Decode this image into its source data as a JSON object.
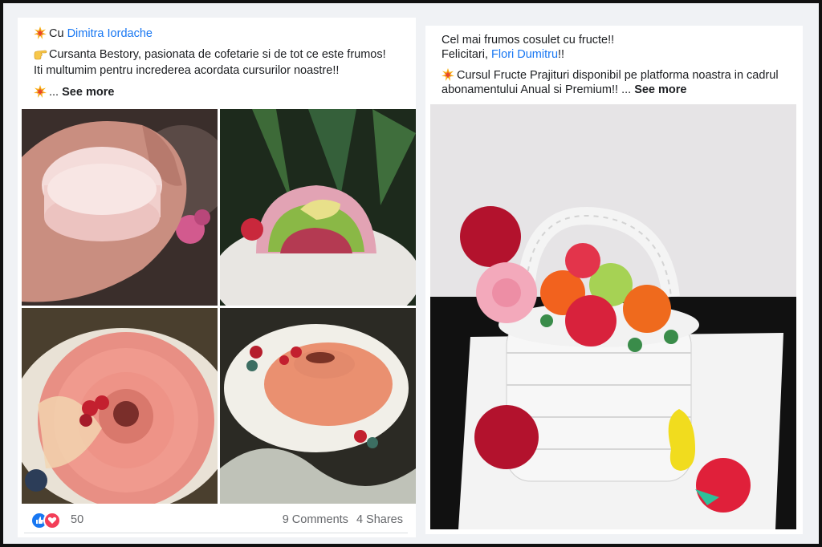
{
  "post_left": {
    "line1_prefix": "Cu",
    "line1_link": "Dimitra Iordache",
    "line2": "Cursanta Bestory, pasionata de cofetarie si de tot ce este frumos!",
    "line3": "Iti multumim pentru increderea acordata cursurilor noastre!!",
    "line4_ellipsis": "...",
    "see_more": "See more",
    "reaction_count": "50",
    "comments": "9 Comments",
    "shares": "4 Shares"
  },
  "post_right": {
    "line1": "Cel mai frumos cosulet cu fructe!!",
    "line2_prefix": "Felicitari,",
    "line2_link": "Flori Dumitru",
    "line2_suffix": "!!",
    "line3": "Cursul Fructe Prajituri disponibil pe platforma noastra in cadrul",
    "line4": "abonamentului Anual si Premium!! ...",
    "see_more": "See more"
  },
  "icons": {
    "burst": "collision-emoji-icon",
    "pointing": "pointing-hand-emoji-icon",
    "like": "like-reaction-icon",
    "love": "love-reaction-icon"
  },
  "colors": {
    "link": "#1877f2",
    "background": "#f0f2f5",
    "muted": "#65676b"
  }
}
